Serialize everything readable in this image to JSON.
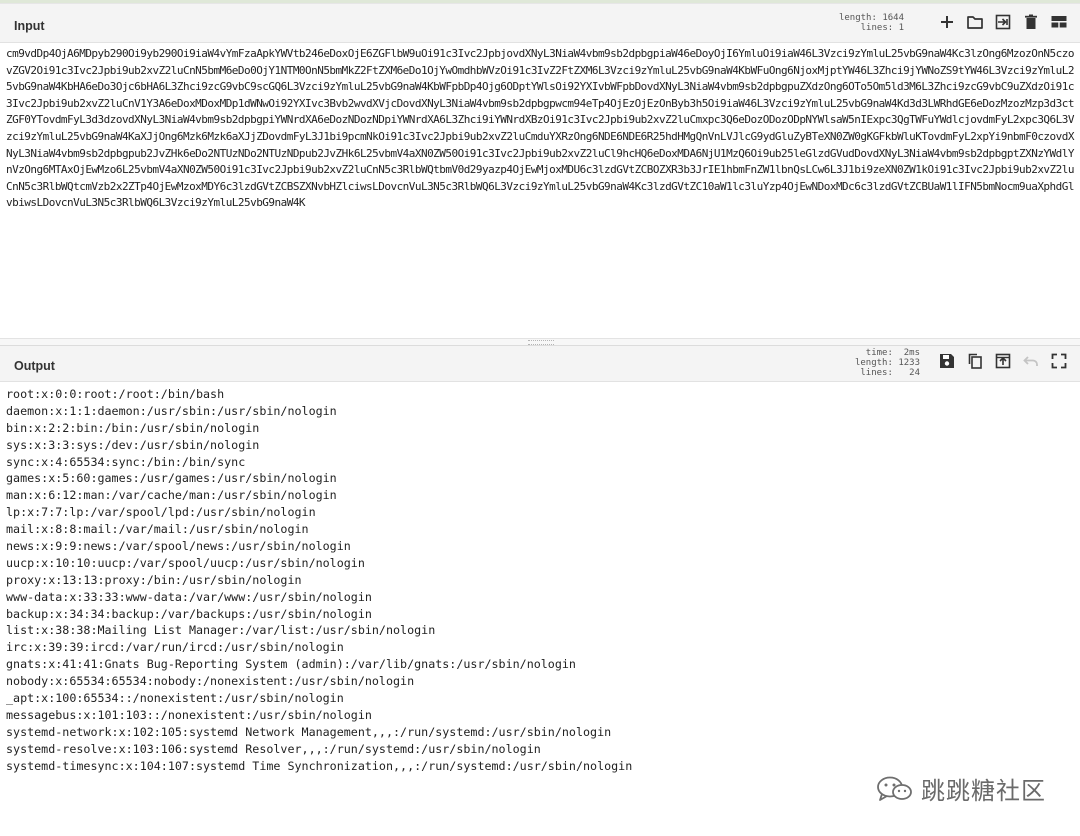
{
  "input_panel": {
    "title": "Input",
    "stats": {
      "length_label": "length:",
      "length_value": "1644",
      "lines_label": "lines:",
      "lines_value": "1"
    },
    "text": "cm9vdDp4OjA6MDpyb290Oi9yb290Oi9iaW4vYmFzaApkYWVtb246eDoxOjE6ZGFlbW9uOi91c3Ivc2JpbjovdXNyL3NiaW4vbm9sb2dpbgpiaW46eDoyOjI6YmluOi9iaW46L3Vzci9zYmluL25vbG9naW4Kc3lzOng6MzozOnN5czovZGV2Oi91c3Ivc2Jpbi9ub2xvZ2luCnN5bmM6eDo0OjY1NTM0OnN5bmMkZ2FtZXM6eDo1OjYwOmdhbWVzOi91c3IvZ2FtZXM6L3Vzci9zYmluL25vbG9naW4KbWFuOng6NjoxMjptYW46L3Zhci9jYWNoZS9tYW46L3Vzci9zYmluL25vbG9naW4KbHA6eDo3Ojc6bHA6L3Zhci9zcG9vbC9scGQ6L3Vzci9zYmluL25vbG9naW4KbWFpbDp4Ojg6ODptYWlsOi92YXIvbWFpbDovdXNyL3NiaW4vbm9sb2dpbgpuZXdzOng6OTo5Om5ld3M6L3Zhci9zcG9vbC9uZXdzOi91c3Ivc2Jpbi9ub2xvZ2luCnV1Y3A6eDoxMDoxMDp1dWNwOi92YXIvc3Bvb2wvdXVjcDovdXNyL3NiaW4vbm9sb2dpbgpwcm94eTp4OjEzOjEzOnByb3h5Oi9iaW46L3Vzci9zYmluL25vbG9naW4Kd3d3LWRhdGE6eDozMzozMzp3d3ctZGF0YTovdmFyL3d3dzovdXNyL3NiaW4vbm9sb2dpbgpiYWNrdXA6eDozNDozNDpiYWNrdXA6L3Zhci9iYWNrdXBzOi91c3Ivc2Jpbi9ub2xvZ2luCmxpc3Q6eDozODozODpNYWlsaW5nIExpc3QgTWFuYWdlcjovdmFyL2xpc3Q6L3Vzci9zYmluL25vbG9naW4KaXJjOng6Mzk6Mzk6aXJjZDovdmFyL3J1bi9pcmNkOi91c3Ivc2Jpbi9ub2xvZ2luCmduYXRzOng6NDE6NDE6R25hdHMgQnVnLVJlcG9ydGluZyBTeXN0ZW0gKGFkbWluKTovdmFyL2xpYi9nbmF0czovdXNyL3NiaW4vbm9sb2dpbgpub2JvZHk6eDo2NTUzNDo2NTUzNDpub2JvZHk6L25vbmV4aXN0ZW50Oi91c3Ivc2Jpbi9ub2xvZ2luCl9hcHQ6eDoxMDA6NjU1MzQ6Oi9ub25leGlzdGVudDovdXNyL3NiaW4vbm9sb2dpbgptZXNzYWdlYnVzOng6MTAxOjEwMzo6L25vbmV4aXN0ZW50Oi91c3Ivc2Jpbi9ub2xvZ2luCnN5c3RlbWQtbmV0d29yazp4OjEwMjoxMDU6c3lzdGVtZCBOZXR3b3JrIE1hbmFnZW1lbnQsLCw6L3J1bi9zeXN0ZW1kOi91c3Ivc2Jpbi9ub2xvZ2luCnN5c3RlbWQtcmVzb2x2ZTp4OjEwMzoxMDY6c3lzdGVtZCBSZXNvbHZlciwsLDovcnVuL3N5c3RlbWQ6L3Vzci9zYmluL25vbG9naW4Kc3lzdGVtZC10aW1lc3luYzp4OjEwNDoxMDc6c3lzdGVtZCBUaW1lIFN5bmNocm9uaXphdGlvbiwsLDovcnVuL3N5c3RlbWQ6L3Vzci9zYmluL25vbG9naW4K"
  },
  "output_panel": {
    "title": "Output",
    "stats": {
      "time_label": "time:",
      "time_value": "2ms",
      "length_label": "length:",
      "length_value": "1233",
      "lines_label": "lines:",
      "lines_value": "24"
    },
    "lines": [
      "root:x:0:0:root:/root:/bin/bash",
      "daemon:x:1:1:daemon:/usr/sbin:/usr/sbin/nologin",
      "bin:x:2:2:bin:/bin:/usr/sbin/nologin",
      "sys:x:3:3:sys:/dev:/usr/sbin/nologin",
      "sync:x:4:65534:sync:/bin:/bin/sync",
      "games:x:5:60:games:/usr/games:/usr/sbin/nologin",
      "man:x:6:12:man:/var/cache/man:/usr/sbin/nologin",
      "lp:x:7:7:lp:/var/spool/lpd:/usr/sbin/nologin",
      "mail:x:8:8:mail:/var/mail:/usr/sbin/nologin",
      "news:x:9:9:news:/var/spool/news:/usr/sbin/nologin",
      "uucp:x:10:10:uucp:/var/spool/uucp:/usr/sbin/nologin",
      "proxy:x:13:13:proxy:/bin:/usr/sbin/nologin",
      "www-data:x:33:33:www-data:/var/www:/usr/sbin/nologin",
      "backup:x:34:34:backup:/var/backups:/usr/sbin/nologin",
      "list:x:38:38:Mailing List Manager:/var/list:/usr/sbin/nologin",
      "irc:x:39:39:ircd:/var/run/ircd:/usr/sbin/nologin",
      "gnats:x:41:41:Gnats Bug-Reporting System (admin):/var/lib/gnats:/usr/sbin/nologin",
      "nobody:x:65534:65534:nobody:/nonexistent:/usr/sbin/nologin",
      "_apt:x:100:65534::/nonexistent:/usr/sbin/nologin",
      "messagebus:x:101:103::/nonexistent:/usr/sbin/nologin",
      "systemd-network:x:102:105:systemd Network Management,,,:/run/systemd:/usr/sbin/nologin",
      "systemd-resolve:x:103:106:systemd Resolver,,,:/run/systemd:/usr/sbin/nologin",
      "systemd-timesync:x:104:107:systemd Time Synchronization,,,:/run/systemd:/usr/sbin/nologin"
    ]
  },
  "watermark": {
    "text": "跳跳糖社区"
  },
  "icons": {
    "input": [
      "add-icon",
      "open-folder-icon",
      "import-icon",
      "delete-icon",
      "layout-icon"
    ],
    "output": [
      "save-icon",
      "copy-icon",
      "replace-input-icon",
      "undo-icon",
      "maximize-icon"
    ]
  },
  "colors": {
    "header_bg": "#f4f4f4",
    "icon": "#333333",
    "icon_disabled": "#c4c4c4",
    "text": "#222222"
  }
}
